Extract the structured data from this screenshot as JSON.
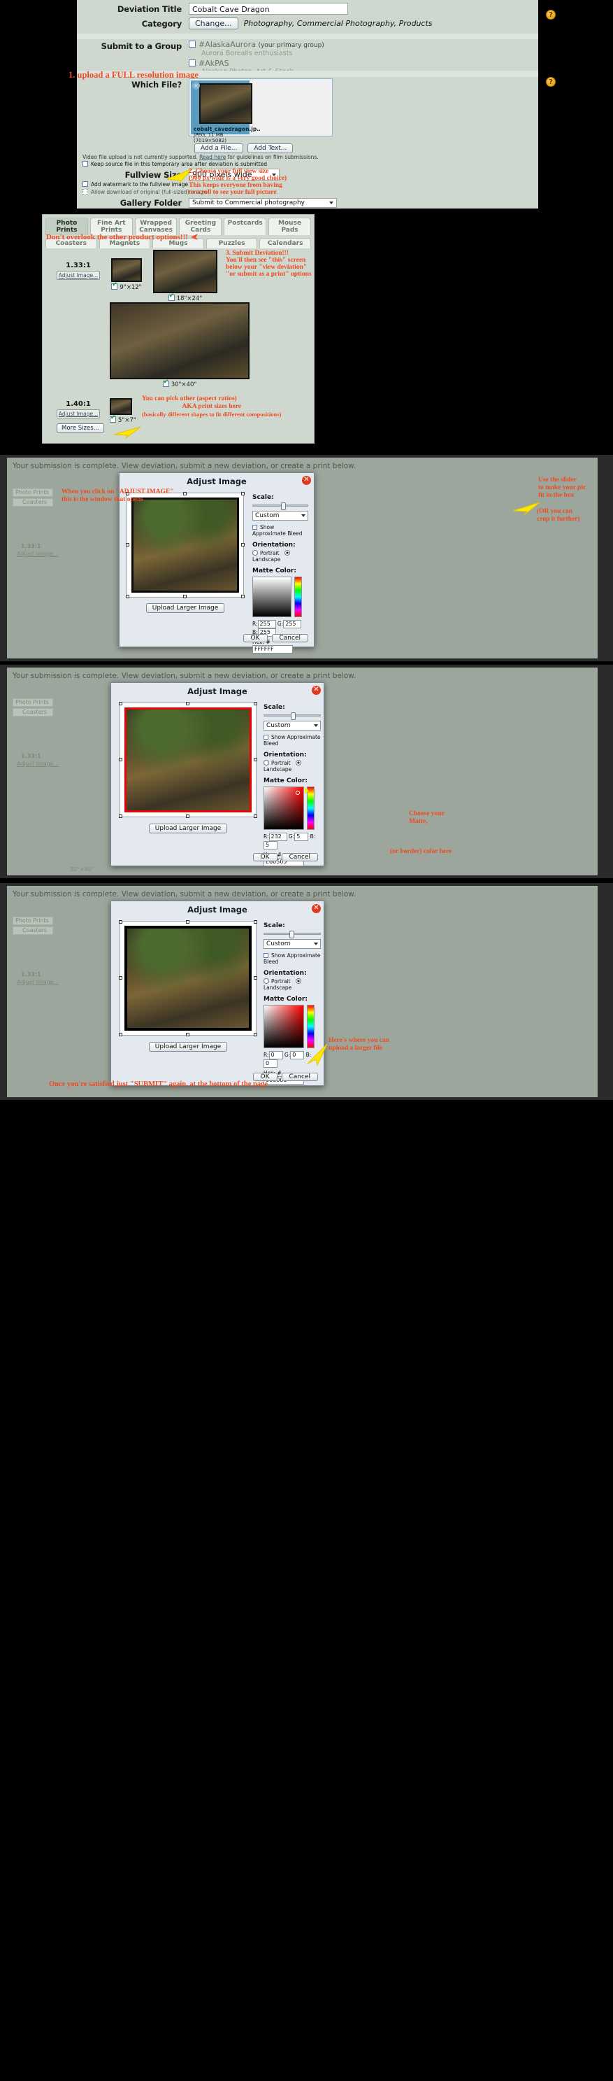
{
  "panel1": {
    "fields": {
      "deviation_title_label": "Deviation Title",
      "deviation_title_value": "Cobalt Cave Dragon",
      "category_label": "Category",
      "category_button": "Change...",
      "category_value": "Photography, Commercial Photography, Products",
      "submit_group_label": "Submit to a Group",
      "group1_name": "#AlaskaAurora",
      "group1_note": "(your primary group)",
      "group1_sub": "Aurora Borealis enthusiasts",
      "group2_name": "#AkPAS",
      "group2_sub": "Alaskan Photos, Art & Stock",
      "which_file_label": "Which File?",
      "file_name": "cobalt_cavedragon.jp..",
      "file_meta1": "JPEG, 11 MB",
      "file_meta2": "(7019×5082)",
      "add_file_button": "Add a File...",
      "add_text_button": "Add Text...",
      "video_note": "Video file upload is not currently supported.",
      "video_note_link": "Read here",
      "video_note_tail": "for guidelines on film submissions.",
      "keep_source_label": "Keep source file in this temporary area after deviation is submitted",
      "fullview_label": "Fullview Size",
      "fullview_value": "900 pixels wide",
      "watermark_label": "Add watermark to the fullview image",
      "download_label": "Allow download of original (full-sized) image",
      "gallery_label": "Gallery Folder",
      "gallery_value": "Submit to Commercial photography",
      "help_glyph": "?"
    },
    "annotations": {
      "upload_full": "1. upload a FULL resolution image",
      "choose_size_l1": "2. Choose your full view size",
      "choose_size_l2": "(900 px wide is a very good choice)",
      "choose_size_l3": "This keeps everyone from having",
      "choose_size_l4": "to scroll to see your full picture"
    }
  },
  "panel2": {
    "tabs_row1": [
      "Photo Prints",
      "Fine Art Prints",
      "Wrapped Canvases",
      "Greeting Cards",
      "Postcards",
      "Mouse Pads"
    ],
    "tabs_row2": [
      "Coasters",
      "Magnets",
      "Mugs",
      "Puzzles",
      "Calendars"
    ],
    "active_tab": "Photo Prints",
    "ratio1": "1.33:1",
    "ratio1_link": "Adjust Image...",
    "ratio2": "1.40:1",
    "ratio2_link": "Adjust Image...",
    "size_9x12": "9\"×12\"",
    "size_18x24": "18\"×24\"",
    "size_30x40": "30\"×40\"",
    "size_5x7": "5\"×7\"",
    "more_sizes": "More Sizes...",
    "annotations": {
      "dont_overlook": "Don't overlook the other product options!!!",
      "submit_l1": "3. Submit Deviation!!!",
      "submit_l2": "You'll then see \"this\" screen",
      "submit_l3": "below your \"view deviation\"",
      "submit_l4": "\"or submit as a print\" options",
      "pick_l1": "You can pick other (aspect ratios)",
      "pick_l2": "AKA print sizes here",
      "pick_l3": "(basically different shapes to fit different compositions)"
    }
  },
  "panel3": {
    "status_bold": "Your submission is complete.",
    "status_rest": "View deviation, submit a new deviation, or create a print below.",
    "dialog_title": "Adjust Image",
    "scale_label": "Scale:",
    "preset_value": "Custom",
    "approx_bleed": "Show Approximate Bleed",
    "orientation_label": "Orientation:",
    "portrait": "Portrait",
    "landscape": "Landscape",
    "matte_label": "Matte Color:",
    "r_label": "R:",
    "r_value": "255",
    "g_label": "G:",
    "g_value": "255",
    "b_label": "B:",
    "b_value": "255",
    "hex_label": "Hex: #",
    "hex_value": "FFFFFF",
    "upload_larger": "Upload Larger Image",
    "ok": "OK",
    "cancel": "Cancel",
    "close_glyph": "✕",
    "ghost": {
      "tab1": "Photo Prints",
      "tab2": "Coasters",
      "ratio": "1.33:1",
      "adjust": "Adjust Image..."
    },
    "annotations": {
      "click_l1": "When you click on \"ADJUST IMAGE\"",
      "click_l2": "this is the window that opens",
      "slider_l1": "Use the slider",
      "slider_l2": "to make your pic",
      "slider_l3": "fit in the box",
      "crop_l1": "(OR you can",
      "crop_l2": "crop it further)"
    }
  },
  "panel4": {
    "status_bold": "Your submission is complete.",
    "status_rest": "View deviation, submit a new deviation, or create a print below.",
    "dialog_title": "Adjust Image",
    "scale_label": "Scale:",
    "preset_value": "Custom",
    "approx_bleed": "Show Approximate Bleed",
    "orientation_label": "Orientation:",
    "portrait": "Portrait",
    "landscape": "Landscape",
    "matte_label": "Matte Color:",
    "r_label": "R:",
    "r_value": "232",
    "g_label": "G:",
    "g_value": "5",
    "b_label": "B:",
    "b_value": "5",
    "hex_label": "Hex: #",
    "hex_value": "E60505",
    "upload_larger": "Upload Larger Image",
    "ok": "OK",
    "cancel": "Cancel",
    "ghost": {
      "tab1": "Photo Prints",
      "tab2": "Coasters",
      "ratio": "1.33:1",
      "adjust": "Adjust Image...",
      "size": "30\"×40\""
    },
    "annotations": {
      "choose_l1": "Choose your",
      "choose_l2": "Matte,",
      "choose_l3": "(or border) color here"
    }
  },
  "panel5": {
    "status_bold": "Your submission is complete.",
    "status_rest": "View deviation, submit a new deviation, or create a print below.",
    "dialog_title": "Adjust Image",
    "scale_label": "Scale:",
    "preset_value": "Custom",
    "approx_bleed": "Show Approximate Bleed",
    "orientation_label": "Orientation:",
    "portrait": "Portrait",
    "landscape": "Landscape",
    "matte_label": "Matte Color:",
    "r_label": "R:",
    "r_value": "0",
    "g_label": "G:",
    "g_value": "0",
    "b_label": "B:",
    "b_value": "0",
    "hex_label": "Hex: #",
    "hex_value": "000000",
    "upload_larger": "Upload Larger Image",
    "ok": "OK",
    "cancel": "Cancel",
    "ghost": {
      "tab1": "Photo Prints",
      "tab2": "Coasters",
      "ratio": "1.33:1",
      "adjust": "Adjust Image..."
    },
    "annotations": {
      "larger_l1": "Here's where you can",
      "larger_l2": "upload a larger file",
      "submit_again": "Once you're satisfied just \"SUBMIT\" again, at the bottom of the page"
    }
  },
  "colors": {
    "annotation": "#f04a1e",
    "arrow": "#ffe800",
    "form_bg": "#cfd8cf",
    "file_card": "#5a9cc0",
    "matte_red": "#E60505"
  }
}
